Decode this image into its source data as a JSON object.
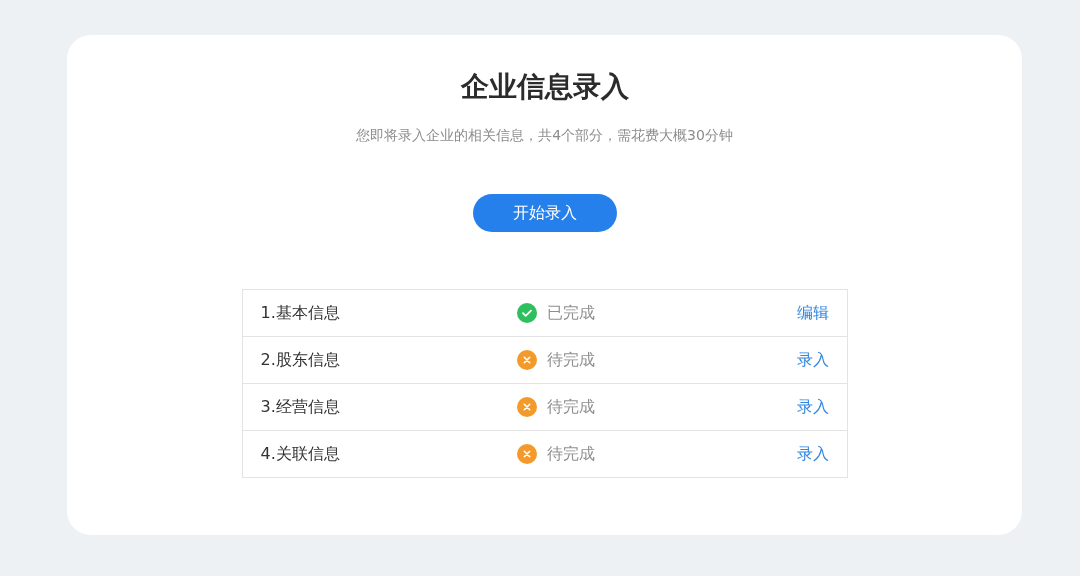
{
  "title": "企业信息录入",
  "subtitle": "您即将录入企业的相关信息，共4个部分，需花费大概30分钟",
  "start_button": "开始录入",
  "sections": [
    {
      "name": "1.基本信息",
      "completed": true,
      "status": "已完成",
      "action": "编辑"
    },
    {
      "name": "2.股东信息",
      "completed": false,
      "status": "待完成",
      "action": "录入"
    },
    {
      "name": "3.经营信息",
      "completed": false,
      "status": "待完成",
      "action": "录入"
    },
    {
      "name": "4.关联信息",
      "completed": false,
      "status": "待完成",
      "action": "录入"
    }
  ]
}
